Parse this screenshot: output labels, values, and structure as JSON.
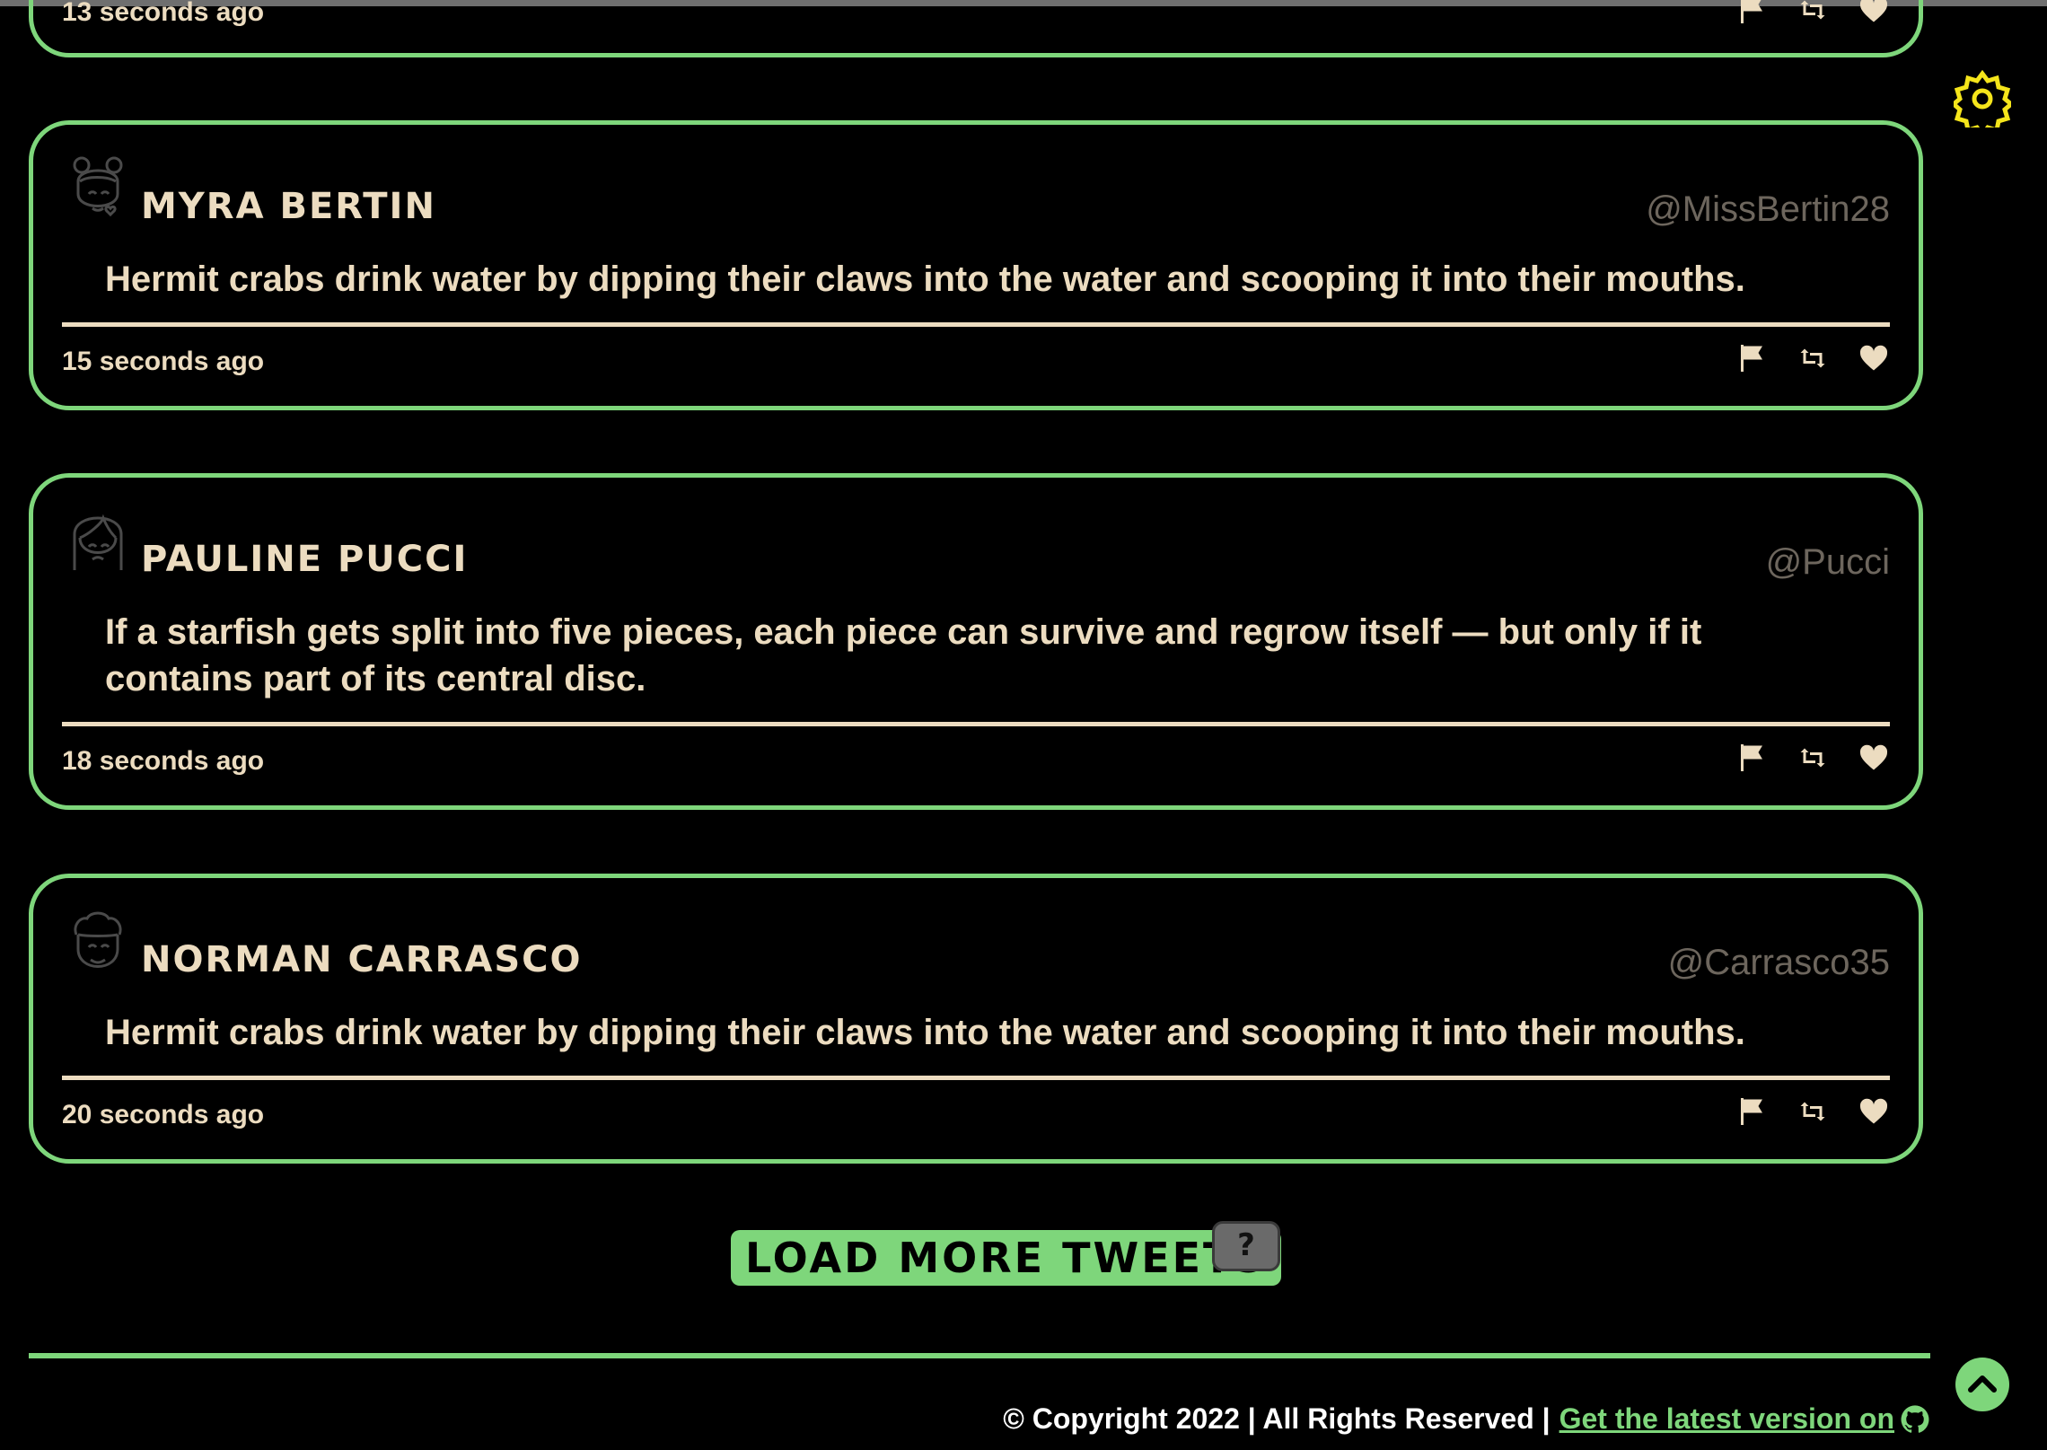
{
  "colors": {
    "accent": "#7ed67b",
    "text": "#ecdcc0",
    "handle": "#6d665d",
    "background": "#000000",
    "gear": "#f5e51b"
  },
  "partial_tweet": {
    "time": "13 seconds ago"
  },
  "tweets": [
    {
      "avatar": "girl-buns-avatar-icon",
      "name": "Myra Bertin",
      "handle": "@MissBertin28",
      "text": "Hermit crabs drink water by dipping their claws into the water and scooping it into their mouths.",
      "time": "15 seconds ago"
    },
    {
      "avatar": "woman-avatar-icon",
      "name": "Pauline Pucci",
      "handle": "@Pucci",
      "text": "If a starfish gets split into five pieces, each piece can survive and regrow itself — but only if it contains part of its central disc.",
      "time": "18 seconds ago"
    },
    {
      "avatar": "man-curly-avatar-icon",
      "name": "Norman Carrasco",
      "handle": "@Carrasco35",
      "text": "Hermit crabs drink water by dipping their claws into the water and scooping it into their mouths.",
      "time": "20 seconds ago"
    }
  ],
  "actions": {
    "flag": "flag-icon",
    "retweet": "retweet-icon",
    "like": "heart-icon"
  },
  "load_more": {
    "label": "Load more tweets",
    "badge": "?"
  },
  "footer": {
    "text": "© Copyright 2022 | All Rights Reserved |",
    "link_label": "Get the latest version on"
  }
}
